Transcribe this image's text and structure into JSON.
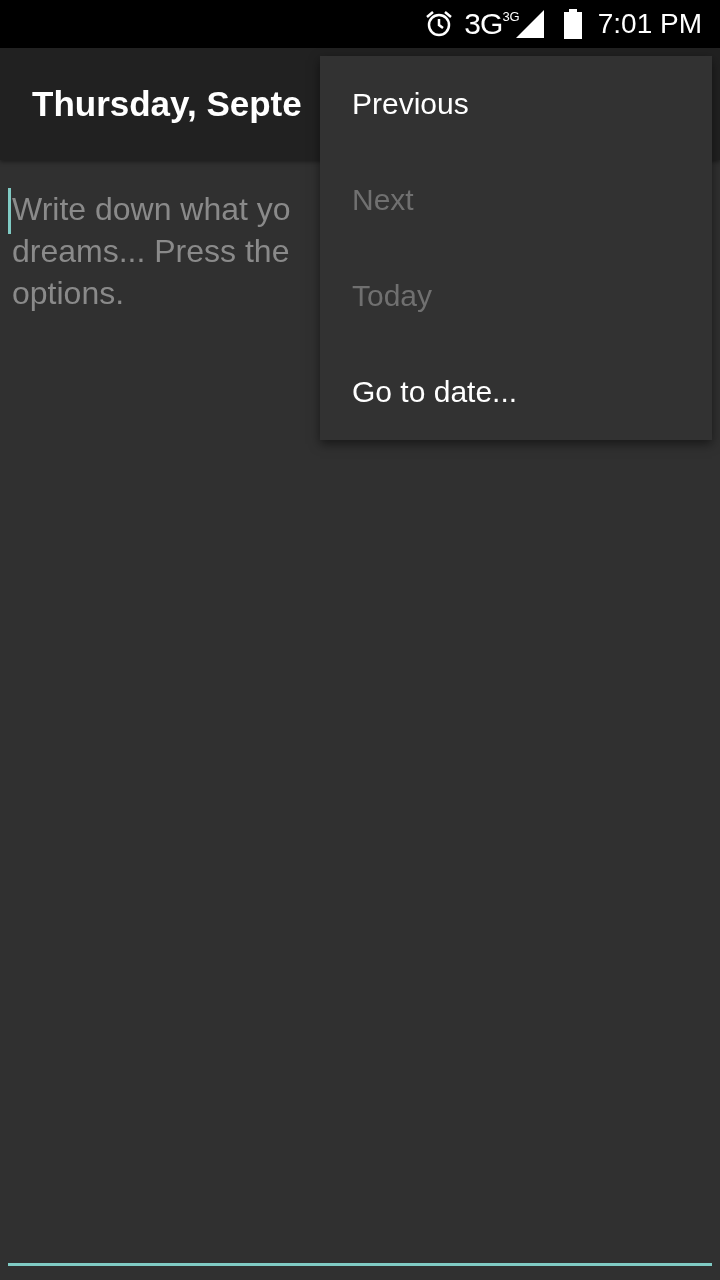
{
  "status_bar": {
    "network": "3G",
    "network_badge": "3G",
    "time": "7:01 PM"
  },
  "app_bar": {
    "title": "Thursday, Septe"
  },
  "note": {
    "placeholder_lines": [
      "Write down what yo",
      "dreams... Press the",
      "options."
    ],
    "focused": true
  },
  "menu": {
    "items": [
      {
        "label": "Previous",
        "disabled": false
      },
      {
        "label": "Next",
        "disabled": true
      },
      {
        "label": "Today",
        "disabled": true
      },
      {
        "label": "Go to date...",
        "disabled": false
      }
    ]
  }
}
